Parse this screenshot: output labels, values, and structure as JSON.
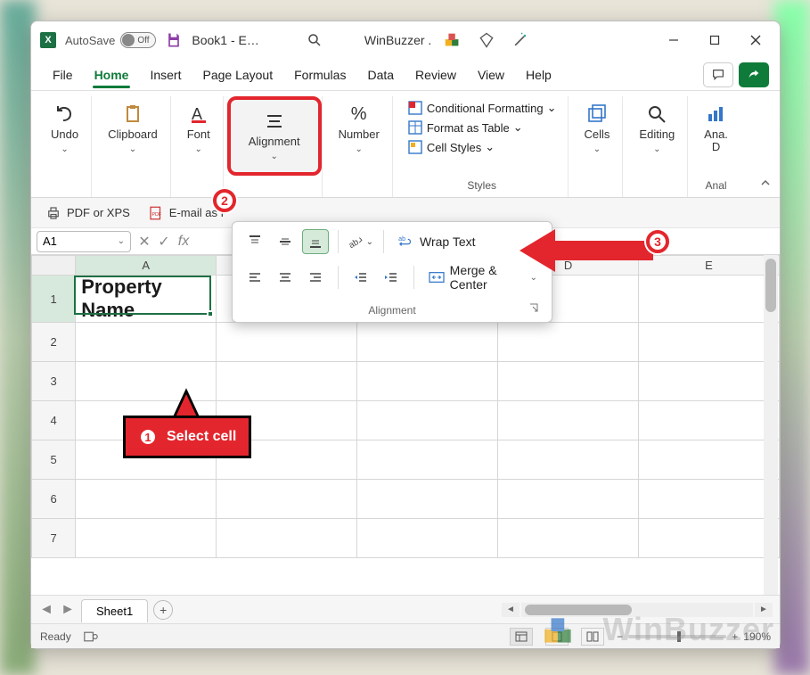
{
  "titlebar": {
    "autosave_label": "AutoSave",
    "autosave_state": "Off",
    "doc_title": "Book1  -  E…",
    "search_hint": "Search",
    "center_text": "WinBuzzer .",
    "window_controls": {
      "min": "Minimize",
      "restore": "Restore",
      "close": "Close"
    }
  },
  "menu": {
    "items": [
      "File",
      "Home",
      "Insert",
      "Page Layout",
      "Formulas",
      "Data",
      "Review",
      "View",
      "Help"
    ],
    "active": "Home",
    "comments_tip": "Comments",
    "share_tip": "Share"
  },
  "ribbon": {
    "undo": "Undo",
    "clipboard": "Clipboard",
    "font": "Font",
    "alignment": "Alignment",
    "number": "Number",
    "styles_label": "Styles",
    "cond_fmt": "Conditional Formatting",
    "fmt_table": "Format as Table",
    "cell_styles": "Cell Styles",
    "cells": "Cells",
    "editing": "Editing",
    "analyze": "Ana.",
    "analyze2": "D",
    "analyze_label": "Anal"
  },
  "qat": {
    "pdf": "PDF or XPS",
    "email": "E-mail as P"
  },
  "dropdown": {
    "wrap_text": "Wrap Text",
    "merge_center": "Merge & Center",
    "group_label": "Alignment",
    "orientation_tip": "Orientation",
    "top_align": "Top Align",
    "middle_align": "Middle Align",
    "bottom_align": "Bottom Align",
    "left_align": "Align Left",
    "center_align": "Center",
    "right_align": "Align Right",
    "dec_indent": "Decrease Indent",
    "inc_indent": "Increase Indent"
  },
  "fxbar": {
    "namebox": "A1",
    "fx_label": "fx"
  },
  "grid": {
    "cols": [
      "A",
      "B",
      "C",
      "D",
      "E"
    ],
    "rows": [
      "1",
      "2",
      "3",
      "4",
      "5",
      "6",
      "7"
    ],
    "cells": {
      "A1": "Property Name"
    },
    "selected_cell": "A1"
  },
  "sheettabs": {
    "active": "Sheet1",
    "add_tip": "New sheet"
  },
  "statusbar": {
    "ready": "Ready",
    "zoom": "190%"
  },
  "annotations": {
    "step1": "Select cell",
    "badge1": "1",
    "badge2": "2",
    "badge3": "3"
  },
  "watermark": "WinBuzzer",
  "colors": {
    "accent": "#0f7b3a",
    "annotation": "#e3262d"
  }
}
